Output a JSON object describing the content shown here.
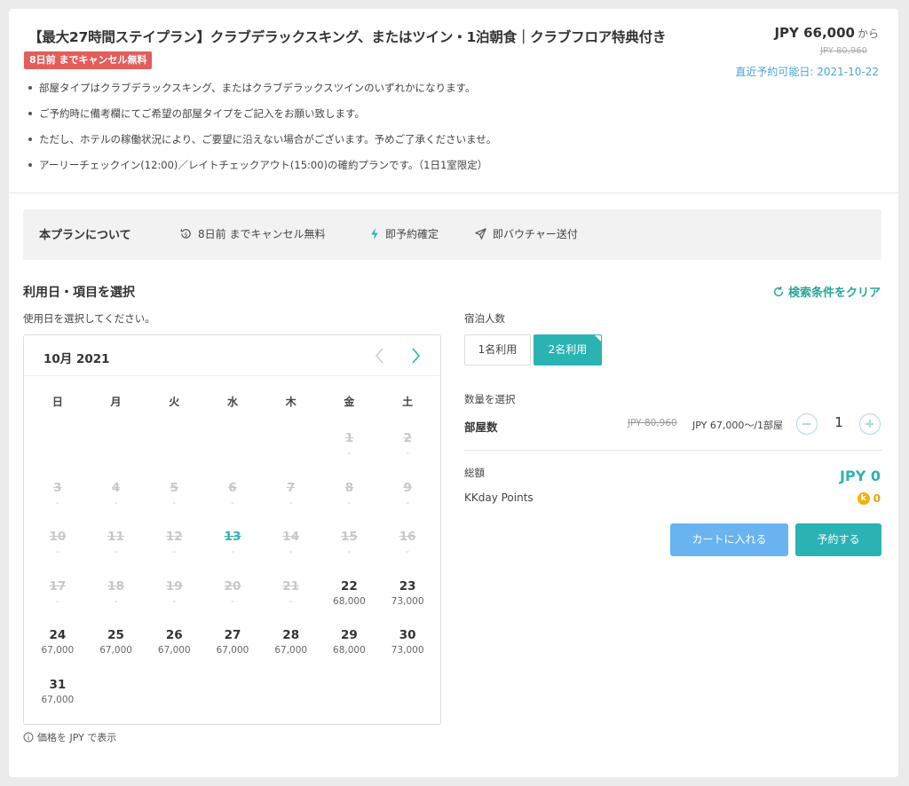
{
  "plan": {
    "title": "【最大27時間ステイプラン】クラブデラックスキング、またはツイン・1泊朝食｜クラブフロア特典付き",
    "cancel_badge": "8日前 までキャンセル無料",
    "bullets": [
      "部屋タイプはクラブデラックスキング、またはクラブデラックスツインのいずれかになります。",
      "ご予約時に備考欄にてご希望の部屋タイプをご記入をお願い致します。",
      "ただし、ホテルの稼働状況により、ご要望に沿えない場合がございます。予めご了承くださいませ。",
      "アーリーチェックイン(12:00)／レイトチェックアウト(15:00)の確約プランです。（1日1室限定）"
    ],
    "price": "JPY 66,000",
    "price_suffix": "から",
    "original_price": "JPY 80,960",
    "latest_date": "直近予約可能日: 2021-10-22"
  },
  "about": {
    "title": "本プランについて",
    "items": [
      {
        "label": "8日前 までキャンセル無料",
        "icon": "cancel-refund-icon"
      },
      {
        "label": "即予約確定",
        "icon": "lightning-icon"
      },
      {
        "label": "即バウチャー送付",
        "icon": "send-icon"
      }
    ]
  },
  "selection": {
    "title": "利用日・項目を選択",
    "clear_label": "検索条件をクリア",
    "date_hint": "使用日を選択してください。",
    "currency_note": "価格を JPY で表示"
  },
  "calendar": {
    "month_label": "10月 2021",
    "weekdays": [
      "日",
      "月",
      "火",
      "水",
      "木",
      "金",
      "土"
    ],
    "leading_blanks": 5,
    "days": [
      {
        "d": "1",
        "p": "-",
        "s": "disabled"
      },
      {
        "d": "2",
        "p": "-",
        "s": "disabled"
      },
      {
        "d": "3",
        "p": "-",
        "s": "disabled"
      },
      {
        "d": "4",
        "p": "-",
        "s": "disabled"
      },
      {
        "d": "5",
        "p": "-",
        "s": "disabled"
      },
      {
        "d": "6",
        "p": "-",
        "s": "disabled"
      },
      {
        "d": "7",
        "p": "-",
        "s": "disabled"
      },
      {
        "d": "8",
        "p": "-",
        "s": "disabled"
      },
      {
        "d": "9",
        "p": "-",
        "s": "disabled"
      },
      {
        "d": "10",
        "p": "-",
        "s": "disabled"
      },
      {
        "d": "11",
        "p": "-",
        "s": "disabled"
      },
      {
        "d": "12",
        "p": "-",
        "s": "disabled"
      },
      {
        "d": "13",
        "p": "-",
        "s": "disabled today"
      },
      {
        "d": "14",
        "p": "-",
        "s": "disabled"
      },
      {
        "d": "15",
        "p": "-",
        "s": "disabled"
      },
      {
        "d": "16",
        "p": "-",
        "s": "disabled"
      },
      {
        "d": "17",
        "p": "-",
        "s": "disabled"
      },
      {
        "d": "18",
        "p": "-",
        "s": "disabled"
      },
      {
        "d": "19",
        "p": "-",
        "s": "disabled"
      },
      {
        "d": "20",
        "p": "-",
        "s": "disabled"
      },
      {
        "d": "21",
        "p": "-",
        "s": "disabled"
      },
      {
        "d": "22",
        "p": "68,000",
        "s": "avail"
      },
      {
        "d": "23",
        "p": "73,000",
        "s": "avail"
      },
      {
        "d": "24",
        "p": "67,000",
        "s": "avail"
      },
      {
        "d": "25",
        "p": "67,000",
        "s": "avail"
      },
      {
        "d": "26",
        "p": "67,000",
        "s": "avail"
      },
      {
        "d": "27",
        "p": "67,000",
        "s": "avail"
      },
      {
        "d": "28",
        "p": "67,000",
        "s": "avail"
      },
      {
        "d": "29",
        "p": "68,000",
        "s": "avail"
      },
      {
        "d": "30",
        "p": "73,000",
        "s": "avail"
      },
      {
        "d": "31",
        "p": "67,000",
        "s": "avail"
      }
    ]
  },
  "guests": {
    "label": "宿泊人数",
    "options": [
      "1名利用",
      "2名利用"
    ],
    "selected_index": 1
  },
  "quantity": {
    "label": "数量を選択",
    "rooms_label": "部屋数",
    "original_price": "JPY 80,960",
    "unit_price": "JPY 67,000〜/1部屋",
    "value": "1"
  },
  "totals": {
    "total_label": "総額",
    "total_value": "JPY 0",
    "points_label": "KKday Points",
    "points_value": "0"
  },
  "actions": {
    "cart_label": "カートに入れる",
    "book_label": "予約する"
  },
  "colors": {
    "accent": "#2bb3b3",
    "cart_blue": "#69b4f0",
    "badge_red": "#e35d5b",
    "date_blue": "#4aa3d8",
    "points_gold": "#f0b400"
  }
}
